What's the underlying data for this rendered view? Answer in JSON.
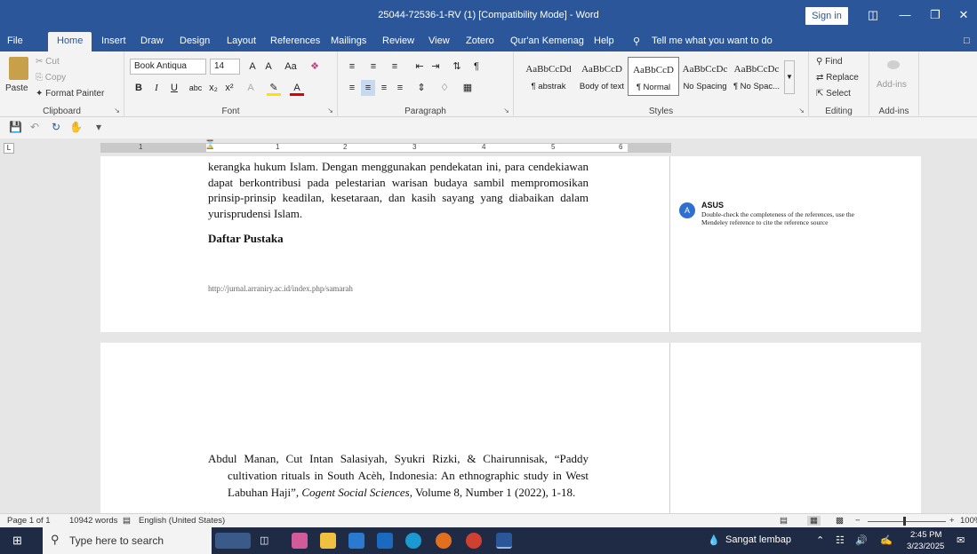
{
  "window": {
    "title": "25044-72536-1-RV (1) [Compatibility Mode] - Word",
    "sign_in": "Sign in"
  },
  "tabs": [
    "File",
    "Home",
    "Insert",
    "Draw",
    "Design",
    "Layout",
    "References",
    "Mailings",
    "Review",
    "View",
    "Zotero",
    "Qur'an Kemenag",
    "Help"
  ],
  "active_tab": "Home",
  "tell_me": "Tell me what you want to do",
  "clipboard": {
    "paste": "Paste",
    "cut": "Cut",
    "copy": "Copy",
    "format_painter": "Format Painter",
    "label": "Clipboard"
  },
  "font": {
    "name": "Book Antiqua",
    "size": "14",
    "label": "Font"
  },
  "paragraph": {
    "label": "Paragraph"
  },
  "styles": {
    "label": "Styles",
    "items": [
      {
        "preview": "AaBbCcDd",
        "name": "¶ abstrak"
      },
      {
        "preview": "AaBbCcD",
        "name": "Body of text"
      },
      {
        "preview": "AaBbCcD",
        "name": "¶ Normal"
      },
      {
        "preview": "AaBbCcDc",
        "name": "No Spacing"
      },
      {
        "preview": "AaBbCcDc",
        "name": "¶ No Spac..."
      }
    ]
  },
  "editing": {
    "find": "Find",
    "replace": "Replace",
    "select": "Select",
    "label": "Editing"
  },
  "addins": {
    "button": "Add-ins",
    "label": "Add-ins"
  },
  "ruler": {
    "numbers": [
      "1",
      "2",
      "3",
      "4",
      "5",
      "6"
    ]
  },
  "document": {
    "paragraph": "kerangka hukum Islam. Dengan menggunakan pendekatan ini, para cendekiawan dapat berkontribusi pada pelestarian warisan budaya sambil mempromosikan prinsip-prinsip keadilan, kesetaraan, dan kasih sayang yang diabaikan dalam yurisprudensi Islam.",
    "heading": "Daftar Pustaka",
    "footer_url": "http://jurnal.arraniry.ac.id/index.php/samarah",
    "reference": {
      "authors": "Abdul Manan, Cut Intan Salasiyah, Syukri Rizki, & Chairunnisak, “Paddy cultivation rituals in South Acèh, Indonesia: An ethnographic study in West Labuhan Haji”, ",
      "journal": "Cogent Social Sciences,",
      "rest": " Volume 8, Number 1 (2022), 1-18."
    }
  },
  "comment": {
    "initial": "A",
    "author": "ASUS",
    "text": "Double-check the completeness of the references, use the Mendeley reference to cite the reference source"
  },
  "status": {
    "page": "Page 1 of 1",
    "words": "10942 words",
    "language": "English (United States)",
    "zoom": "100%"
  },
  "taskbar": {
    "search_placeholder": "Type here to search",
    "weather": "Sangat lembap",
    "time": "2:45 PM",
    "date": "3/23/2025"
  }
}
